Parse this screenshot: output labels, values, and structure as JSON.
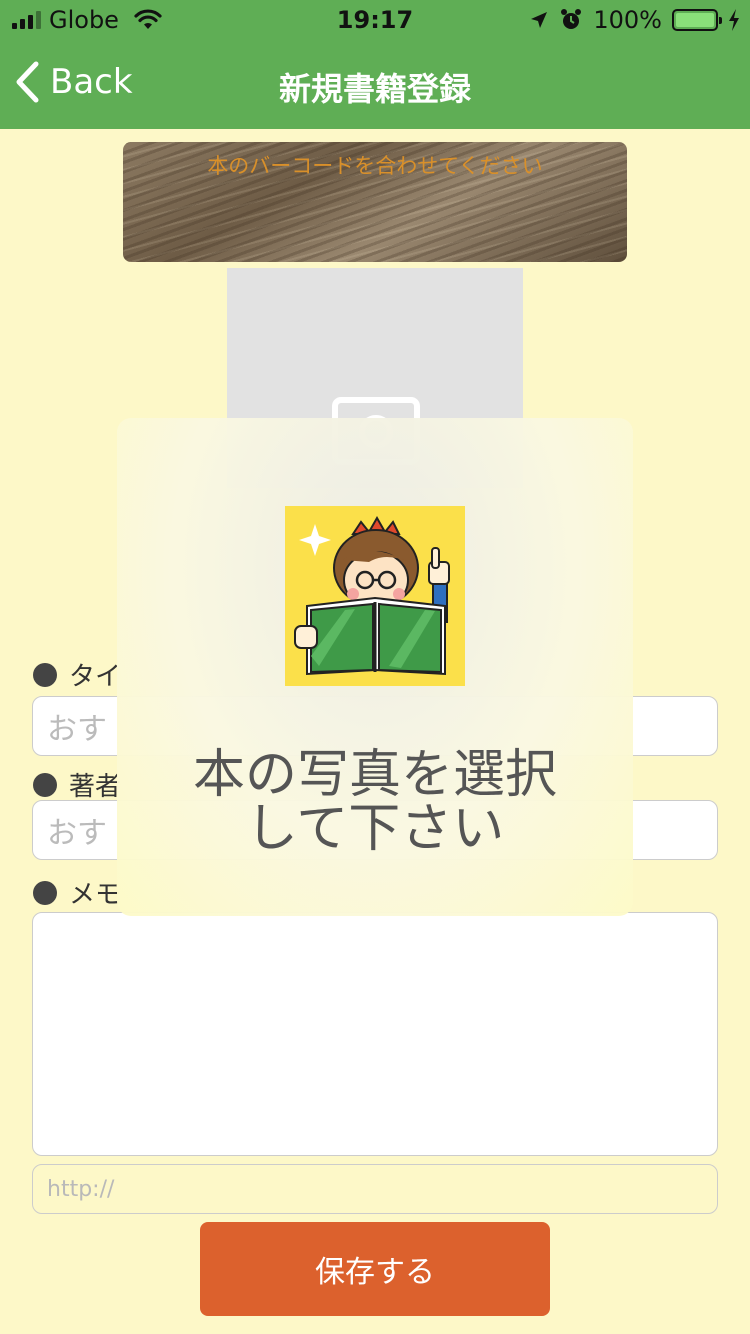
{
  "status_bar": {
    "carrier": "Globe",
    "time": "19:17",
    "battery": "100%",
    "battery_level": 1.0
  },
  "nav": {
    "back_label": "Back",
    "title": "新規書籍登録"
  },
  "camera": {
    "hint": "本のバーコードを合わせてください"
  },
  "form": {
    "title_label": "タイ",
    "title_placeholder": "おす",
    "author_label": "著者",
    "author_placeholder": "おす",
    "memo_label": "メモ",
    "url_placeholder": "http://",
    "save_label": "保存する"
  },
  "hud": {
    "line1": "本の写真を選択",
    "line2": "して下さい"
  },
  "colors": {
    "nav_green": "#5fae55",
    "page_background": "#fdf8c8",
    "save_button": "#dc612d",
    "camera_hint": "#d9902a"
  }
}
